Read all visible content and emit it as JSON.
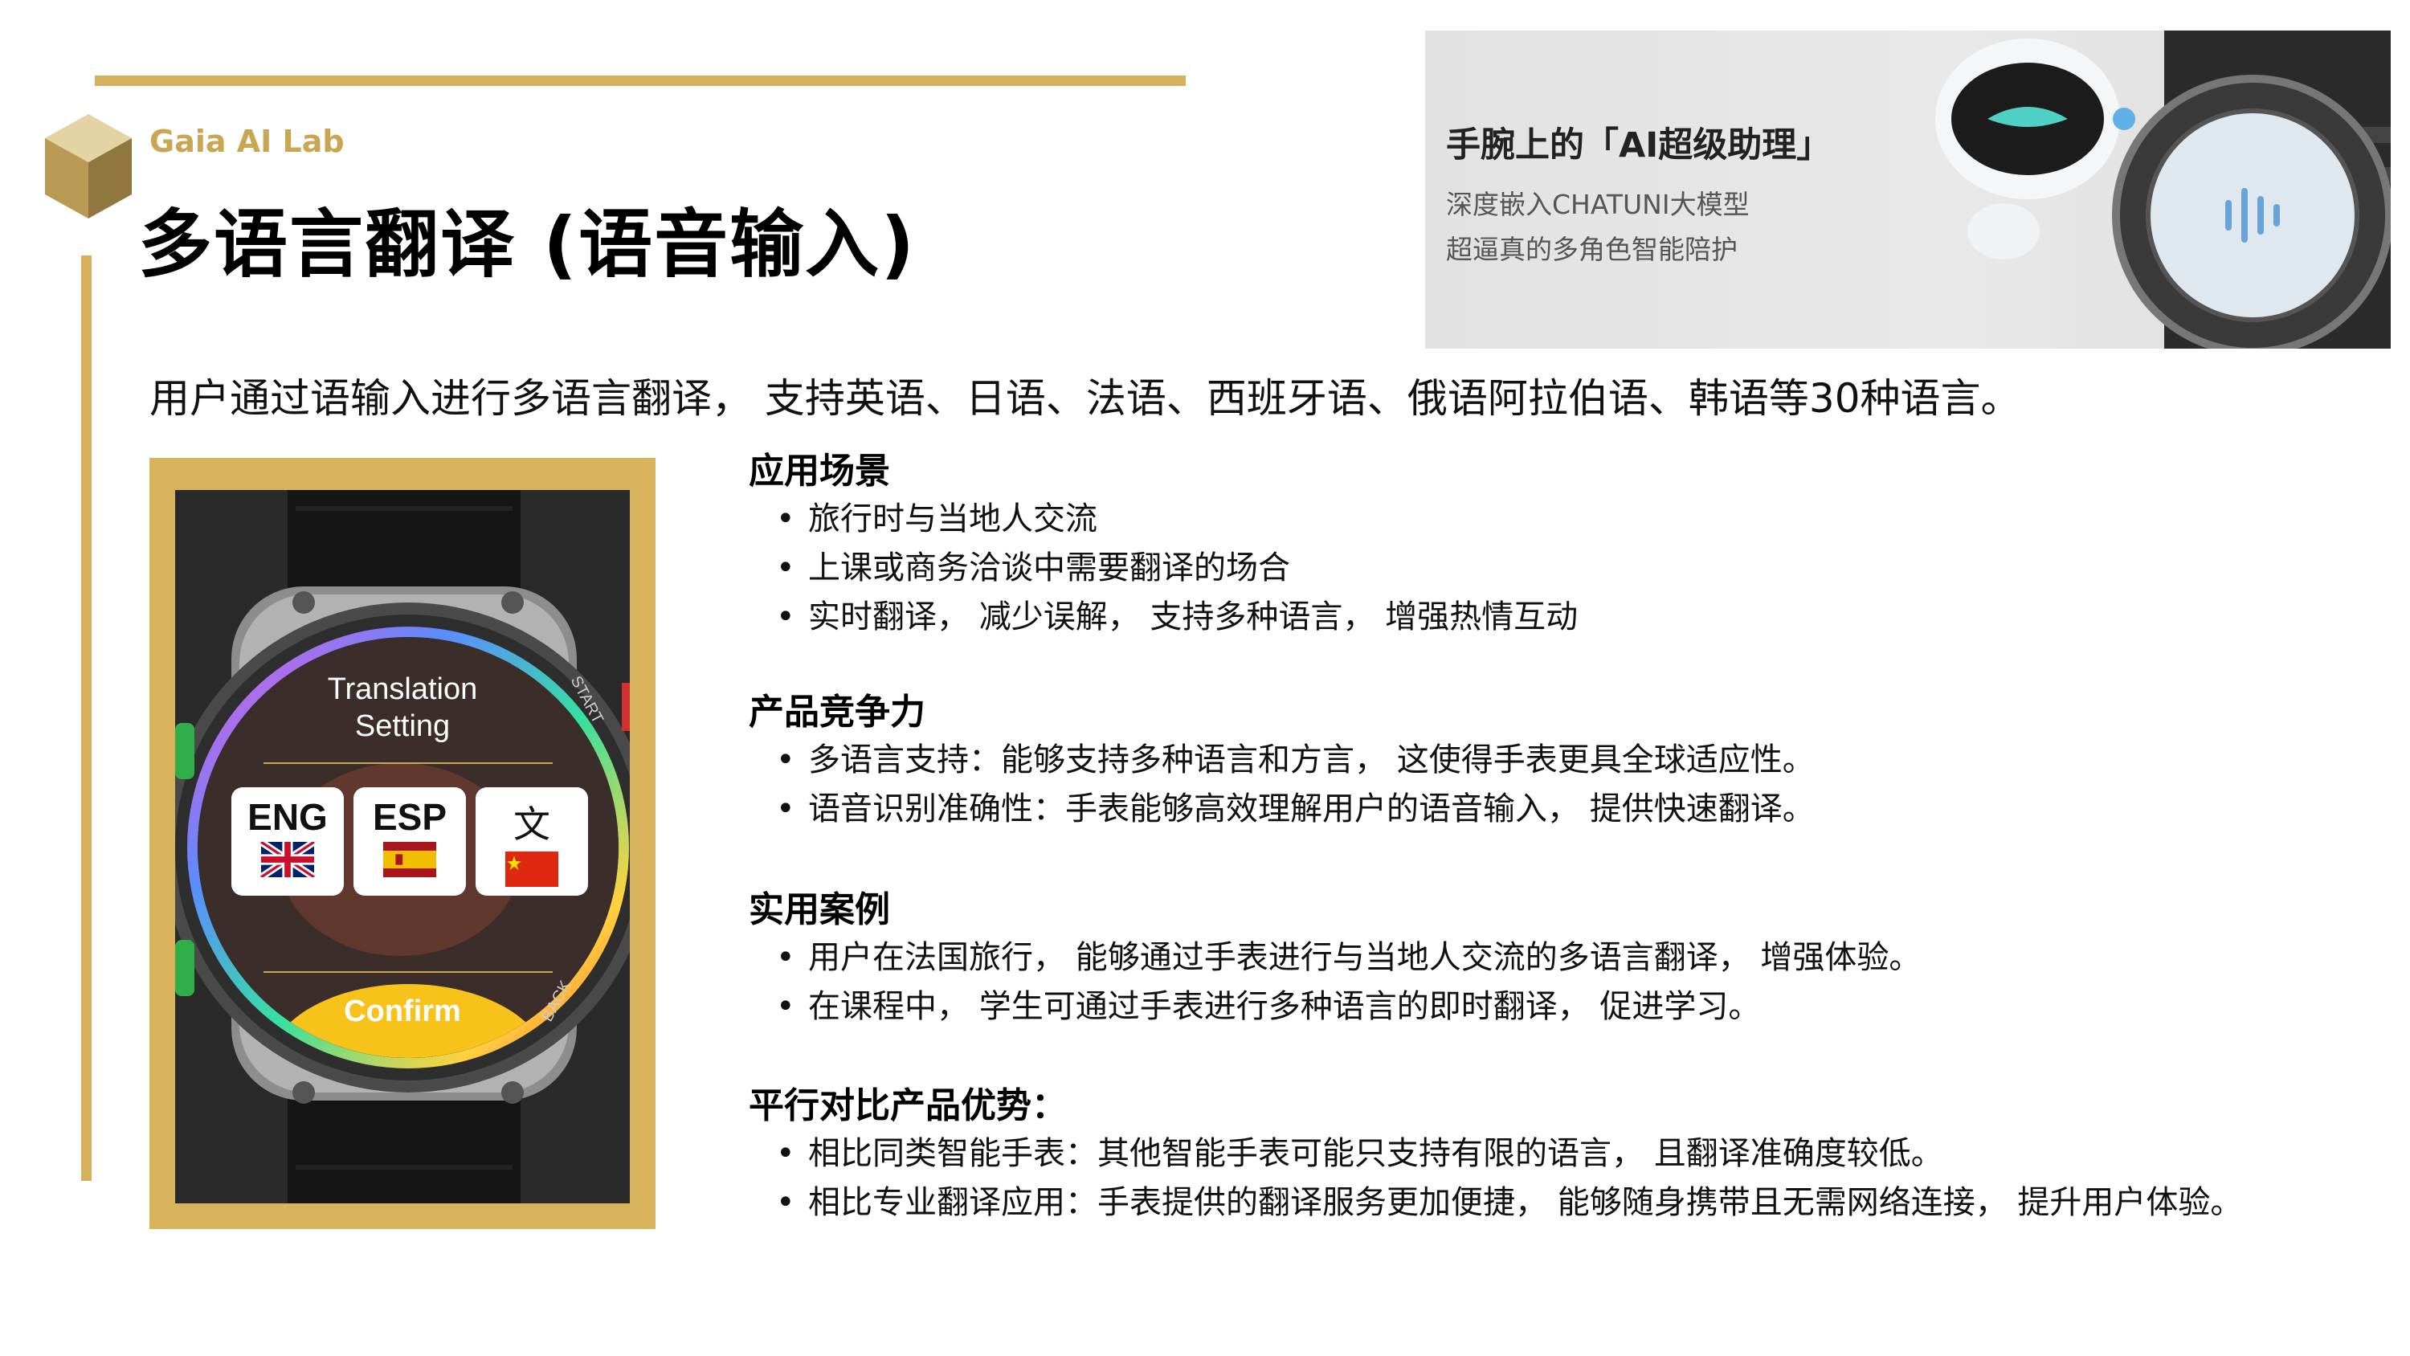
{
  "brand": {
    "name": "Gaia AI Lab",
    "accent_color": "#d6b05c"
  },
  "page": {
    "title": "多语言翻译 (语音输入)"
  },
  "ad_banner": {
    "title": "手腕上的「AI超级助理」",
    "line1": "深度嵌入CHATUNI大模型",
    "line2": "超逼真的多角色智能陪护"
  },
  "intro": "用户通过语输入进行多语言翻译，  支持英语、日语、法语、西班牙语、俄语阿拉伯语、韩语等30种语言。",
  "watch": {
    "heading_line1": "Translation",
    "heading_line2": "Setting",
    "languages": [
      {
        "code": "ENG",
        "flag": "uk-flag-icon"
      },
      {
        "code": "ESP",
        "flag": "spain-flag-icon"
      },
      {
        "code": "文",
        "flag": "china-flag-icon"
      }
    ],
    "confirm_label": "Confirm",
    "bezel_labels": {
      "top_right": "START",
      "bottom_left": "BACK"
    }
  },
  "sections": [
    {
      "title": "应用场景",
      "items": [
        "旅行时与当地人交流",
        "上课或商务洽谈中需要翻译的场合",
        "实时翻译，  减少误解，  支持多种语言，  增强热情互动"
      ]
    },
    {
      "title": "产品竞争力",
      "items": [
        "多语言支持：能够支持多种语言和方言，  这使得手表更具全球适应性。",
        "语音识别准确性：手表能够高效理解用户的语音输入，  提供快速翻译。"
      ]
    },
    {
      "title": "实用案例",
      "items": [
        "用户在法国旅行，  能够通过手表进行与当地人交流的多语言翻译，  增强体验。",
        "在课程中，  学生可通过手表进行多种语言的即时翻译，  促进学习。"
      ]
    },
    {
      "title": "平行对比产品优势：",
      "items": [
        "相比同类智能手表：其他智能手表可能只支持有限的语言，  且翻译准确度较低。",
        "相比专业翻译应用：手表提供的翻译服务更加便捷，  能够随身携带且无需网络连接，  提升用户体验。"
      ]
    }
  ]
}
